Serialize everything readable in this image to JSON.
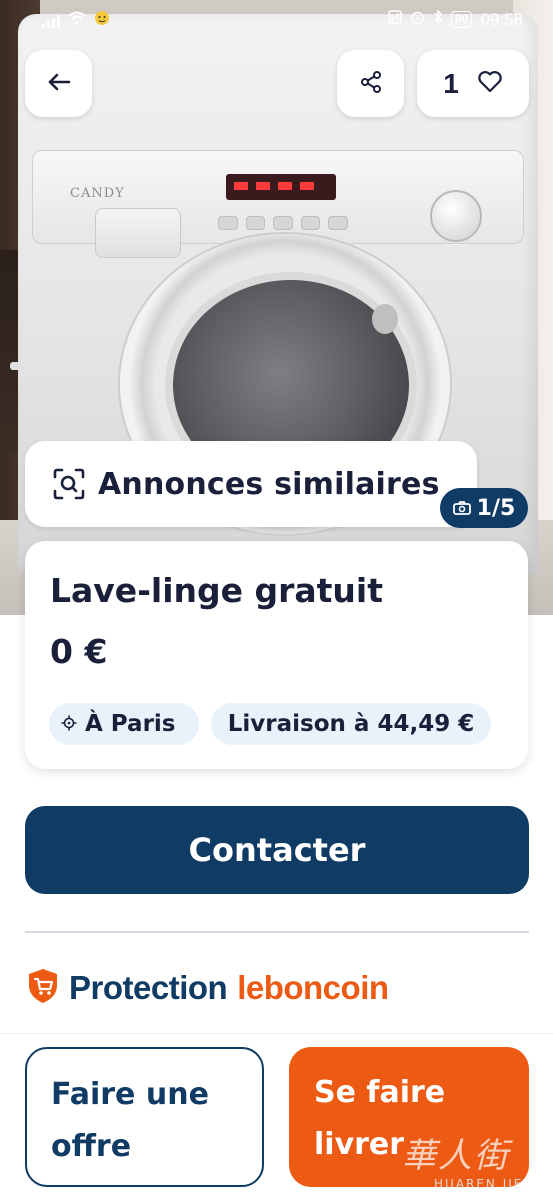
{
  "status_bar": {
    "time": "09:58",
    "battery": "90"
  },
  "header": {
    "favorites_count": "1"
  },
  "photo": {
    "brand_text": "CANDY",
    "counter": "1/5"
  },
  "similar_ads": {
    "label": "Annonces similaires"
  },
  "listing": {
    "title": "Lave-linge gratuit",
    "price": "0 €",
    "location": "À Paris",
    "shipping": "Livraison à 44,49 €"
  },
  "actions": {
    "contact_label": "Contacter",
    "offer_line1": "Faire une",
    "offer_line2": "offre",
    "deliver_line1": "Se faire",
    "deliver_line2": "livrer"
  },
  "protection": {
    "word1": "Protection",
    "word2": "leboncoin"
  },
  "watermark": {
    "cjk": "華人街",
    "latin": "HUAREN JIE"
  },
  "colors": {
    "navy": "#0f3b64",
    "orange": "#ec5a13",
    "chip_bg": "#e9f1fb"
  },
  "icons": [
    "back-arrow-icon",
    "share-icon",
    "heart-icon",
    "image-search-icon",
    "camera-icon",
    "location-target-icon",
    "shield-cart-icon"
  ]
}
